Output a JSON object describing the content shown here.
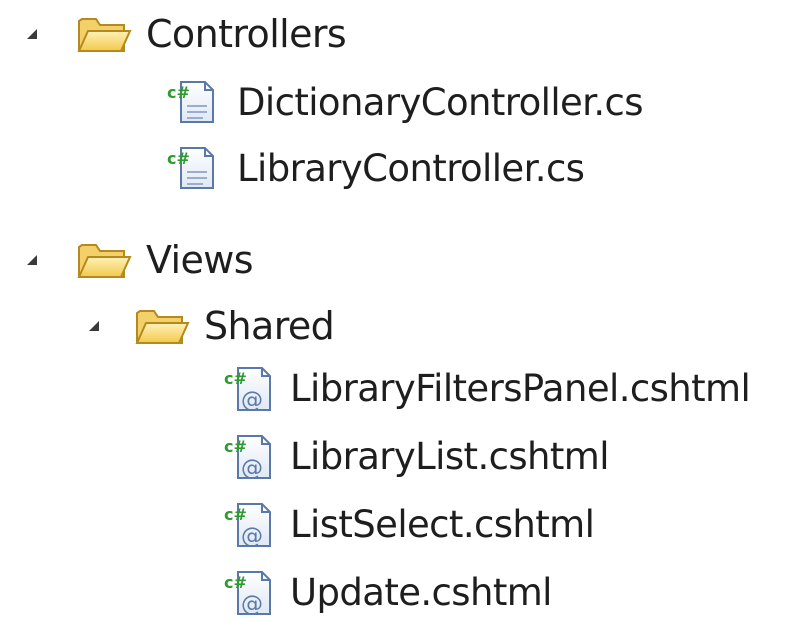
{
  "tree": {
    "controllers": {
      "label": "Controllers",
      "icon": "folder-icon",
      "expanded": true,
      "files": [
        {
          "label": "DictionaryController.cs",
          "icon": "csharp-file-icon"
        },
        {
          "label": "LibraryController.cs",
          "icon": "csharp-file-icon"
        }
      ]
    },
    "views": {
      "label": "Views",
      "icon": "folder-icon",
      "expanded": true,
      "shared": {
        "label": "Shared",
        "icon": "folder-icon",
        "expanded": true,
        "files": [
          {
            "label": "LibraryFiltersPanel.cshtml",
            "icon": "razor-file-icon"
          },
          {
            "label": "LibraryList.cshtml",
            "icon": "razor-file-icon"
          },
          {
            "label": "ListSelect.cshtml",
            "icon": "razor-file-icon"
          },
          {
            "label": "Update.cshtml",
            "icon": "razor-file-icon"
          }
        ]
      }
    }
  },
  "colors": {
    "text": "#1e1e1e",
    "folder_fill": "#f7d96b",
    "folder_stroke": "#b48a1e",
    "csharp_green": "#2e9b2e",
    "file_stroke": "#5b79a8",
    "expander": "#3a3a3a"
  }
}
